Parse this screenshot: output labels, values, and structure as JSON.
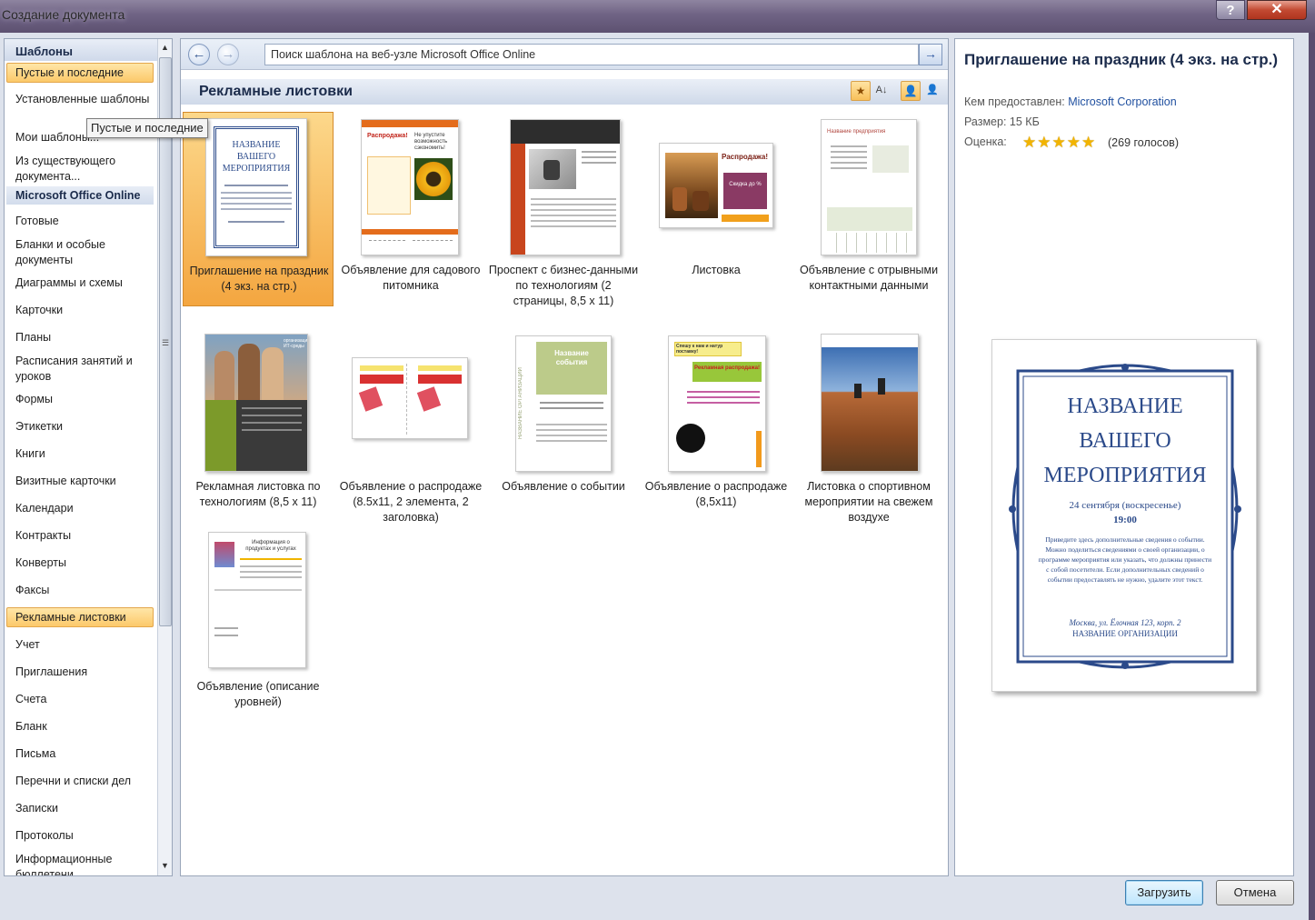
{
  "window": {
    "title": "Создание документа",
    "help_label": "?",
    "close_label": "✕"
  },
  "tooltip": "Пустые и последние",
  "sidebar": {
    "header": "Шаблоны",
    "items": [
      {
        "label": "Пустые и последние",
        "selected": true
      },
      {
        "label": "Установленные шаблоны"
      },
      {
        "label": "Мои шаблоны..."
      },
      {
        "label": "Из существующего документа..."
      },
      {
        "label": "Microsoft Office Online",
        "section": true
      },
      {
        "label": "Готовые"
      },
      {
        "label": "Бланки и особые документы"
      },
      {
        "label": "Диаграммы и схемы"
      },
      {
        "label": "Карточки"
      },
      {
        "label": "Планы"
      },
      {
        "label": "Расписания занятий и уроков"
      },
      {
        "label": "Формы"
      },
      {
        "label": "Этикетки"
      },
      {
        "label": "Книги"
      },
      {
        "label": "Визитные карточки"
      },
      {
        "label": "Календари"
      },
      {
        "label": "Контракты"
      },
      {
        "label": "Конверты"
      },
      {
        "label": "Факсы"
      },
      {
        "label": "Рекламные листовки",
        "selected": true
      },
      {
        "label": "Учет"
      },
      {
        "label": "Приглашения"
      },
      {
        "label": "Счета"
      },
      {
        "label": "Бланк"
      },
      {
        "label": "Письма"
      },
      {
        "label": "Перечни и списки дел"
      },
      {
        "label": "Записки"
      },
      {
        "label": "Протоколы"
      },
      {
        "label": "Информационные бюллетени"
      }
    ]
  },
  "navigation": {
    "back_icon": "back-arrow-icon",
    "forward_icon": "forward-arrow-icon",
    "search_placeholder": "Поиск шаблона на веб-узле Microsoft Office Online",
    "go_icon": "go-arrow-icon"
  },
  "gallery": {
    "section_title": "Рекламные листовки",
    "templates": [
      {
        "label": "Приглашение на праздник (4 экз. на стр.)",
        "selected": true
      },
      {
        "label": "Объявление для садового питомника"
      },
      {
        "label": "Проспект с бизнес-данными по технологиям (2 страницы, 8,5 x 11)"
      },
      {
        "label": "Листовка"
      },
      {
        "label": "Объявление с отрывными контактными данными"
      },
      {
        "label": "Рекламная листовка по технологиям (8,5 x 11)"
      },
      {
        "label": "Объявление о распродаже (8.5x11, 2 элемента, 2 заголовка)"
      },
      {
        "label": "Объявление о событии"
      },
      {
        "label": "Объявление о распродаже (8,5x11)"
      },
      {
        "label": "Листовка о спортивном мероприятии на свежем воздухе"
      },
      {
        "label": "Объявление (описание уровней)"
      }
    ],
    "thumb_texts": {
      "invite": [
        "НАЗВАНИЕ",
        "ВАШЕГО",
        "МЕРОПРИЯТИЯ"
      ],
      "sale_red": "Распродажа!",
      "sale_sub": "Скидка 25%",
      "garden_head": "Не упустите возможность сэкономить!",
      "flyer_sale": "Распродажа!",
      "flyer_discount": "Скидка до %",
      "tear_title": "Название предприятия",
      "tech_org": "организация ИТ-среды",
      "event_name": "Название события",
      "event_side": "НАЗВАНИЕ ОРГАНИЗАЦИИ",
      "sale_hurry": "Спешу к нам и натур поставку!",
      "sale_big": "Рекламная распродажа!",
      "info_title": "Информация о продуктах и услугах"
    }
  },
  "preview": {
    "title": "Приглашение на праздник (4 экз. на стр.)",
    "provider_label": "Кем предоставлен:",
    "provider": "Microsoft Corporation",
    "size_label": "Размер:",
    "size": "15 КБ",
    "rating_label": "Оценка:",
    "stars": "★★★★★",
    "votes": "(269 голосов)",
    "page": {
      "line1": "НАЗВАНИЕ",
      "line2": "ВАШЕГО",
      "line3": "МЕРОПРИЯТИЯ",
      "date": "24 сентября (воскресенье)",
      "time": "19:00",
      "body": "Приведите здесь дополнительные сведения о событии. Можно поделиться сведениями о своей организации, о программе мероприятия или указать, что должны принести с собой посетители. Если дополнительных сведений о событии предоставлять не нужно, удалите этот текст.",
      "address": "Москва, ул. Ёлочная 123, корп. 2",
      "org": "НАЗВАНИЕ ОРГАНИЗАЦИИ"
    }
  },
  "buttons": {
    "load": "Загрузить",
    "cancel": "Отмена"
  }
}
